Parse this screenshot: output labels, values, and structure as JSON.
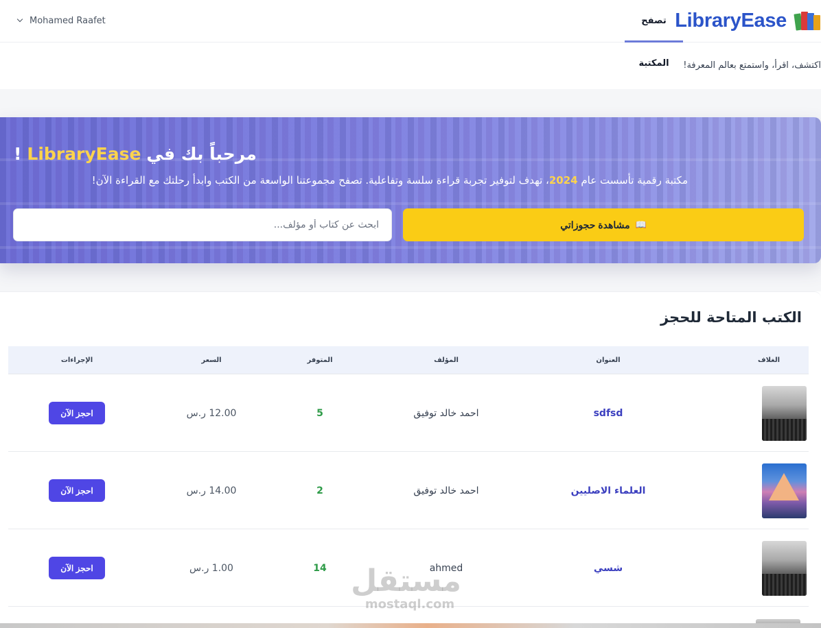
{
  "navbar": {
    "brand": "LibraryEase",
    "browse_link": "تصفح المكتبة",
    "user_name": "Mohamed Raafet"
  },
  "tagline": "اكتشف، اقرأ، واستمتع بعالم المعرفة!",
  "hero": {
    "title_prefix": "مرحباً بك في",
    "title_brand": "LibraryEase",
    "title_suffix": "!",
    "desc_before": "مكتبة رقمية تأسست عام",
    "desc_year": "2024",
    "desc_after": "، تهدف لتوفير تجربة قراءة سلسة وتفاعلية. تصفح مجموعتنا الواسعة من الكتب وابدأ رحلتك مع القراءة الآن!",
    "bookings_button": "مشاهدة حجوزاتي",
    "bookings_icon": "📖",
    "search_placeholder": "ابحث عن كتاب أو مؤلف..."
  },
  "books": {
    "section_title": "الكتب المتاحة للحجز",
    "columns": [
      "الغلاف",
      "العنوان",
      "المؤلف",
      "المتوفر",
      "السعر",
      "الإجراءات"
    ],
    "rows": [
      {
        "cover": "misty-forest-cover",
        "title": "sdfsd",
        "author": "احمد خالد توفيق",
        "available": "5",
        "price": "12.00 ر.س",
        "action": "احجز الآن"
      },
      {
        "cover": "mountain-peak-cover",
        "title": "العلماء الاصليين",
        "author": "احمد خالد توفيق",
        "available": "2",
        "price": "14.00 ر.س",
        "action": "احجز الآن"
      },
      {
        "cover": "misty-forest-cover",
        "title": "شسي",
        "author": "ahmed",
        "available": "14",
        "price": "1.00 ر.س",
        "action": "احجز الآن"
      }
    ]
  },
  "watermark": {
    "arabic": "مستقل",
    "latin": "mostaql.com"
  },
  "colors": {
    "brand": "#2b54c9",
    "accent_yellow": "#facc15",
    "button_indigo": "#4f46e5",
    "available_green": "#2e9b48",
    "title_link": "#3b3fbf"
  }
}
